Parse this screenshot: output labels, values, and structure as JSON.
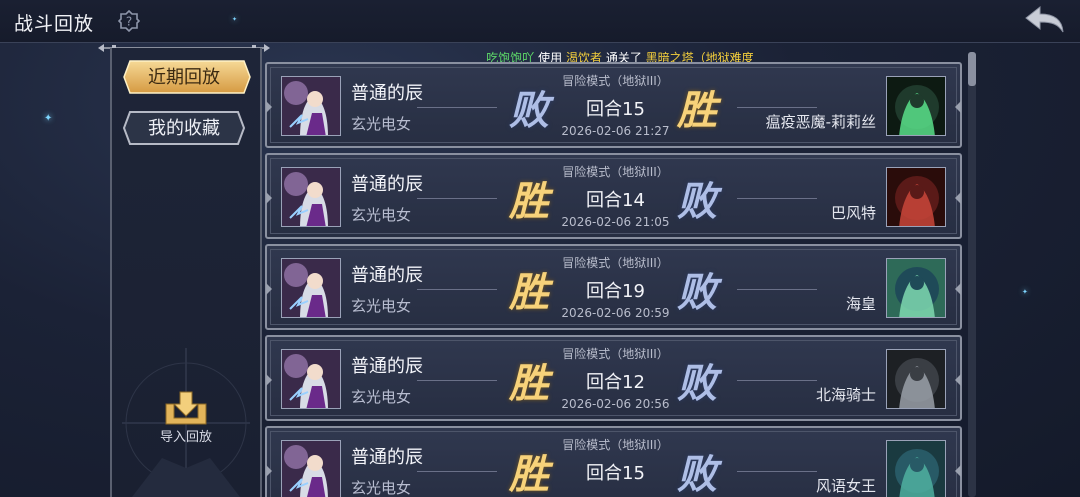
{
  "header": {
    "title": "战斗回放"
  },
  "tabs": [
    {
      "label": "近期回放",
      "active": true
    },
    {
      "label": "我的收藏",
      "active": false
    }
  ],
  "import": {
    "label": "导入回放"
  },
  "banner": {
    "user": "吃饱饱吖",
    "t1": "使用",
    "item": "渴饮者",
    "t2": "通关了",
    "place": "黑暗之塔（地狱难度"
  },
  "matches": [
    {
      "player": "普通的辰",
      "team": "玄光电女",
      "mode": "冒险模式（地狱III）",
      "round": "回合15",
      "time": "2026-02-06 21:27",
      "left_result": "败",
      "right_result": "胜",
      "opponent": "瘟疫恶魔-莉莉丝"
    },
    {
      "player": "普通的辰",
      "team": "玄光电女",
      "mode": "冒险模式（地狱III）",
      "round": "回合14",
      "time": "2026-02-06 21:05",
      "left_result": "胜",
      "right_result": "败",
      "opponent": "巴风特"
    },
    {
      "player": "普通的辰",
      "team": "玄光电女",
      "mode": "冒险模式（地狱III）",
      "round": "回合19",
      "time": "2026-02-06 20:59",
      "left_result": "胜",
      "right_result": "败",
      "opponent": "海皇"
    },
    {
      "player": "普通的辰",
      "team": "玄光电女",
      "mode": "冒险模式（地狱III）",
      "round": "回合12",
      "time": "2026-02-06 20:56",
      "left_result": "胜",
      "right_result": "败",
      "opponent": "北海骑士"
    },
    {
      "player": "普通的辰",
      "team": "玄光电女",
      "mode": "冒险模式（地狱III）",
      "round": "回合15",
      "time": "",
      "left_result": "胜",
      "right_result": "败",
      "opponent": "风语女王"
    }
  ],
  "colors": {
    "win": "#f7d27a",
    "lose": "#aebee6",
    "accent_gold": "#e2b45a",
    "banner_user": "#5fdc6a",
    "banner_highlight": "#f4cf3c"
  },
  "icons": {
    "help": "help-gear-icon",
    "back": "back-arrow-icon",
    "import": "download-box-icon"
  }
}
